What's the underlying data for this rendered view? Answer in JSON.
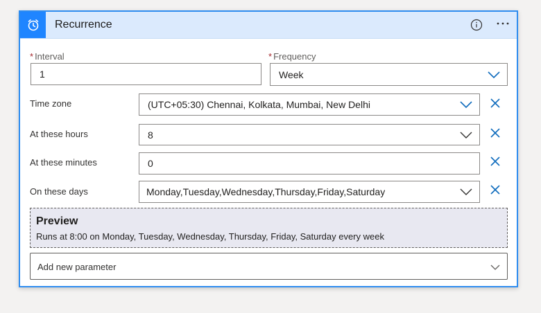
{
  "card": {
    "title": "Recurrence",
    "trigger_icon": "alarm-clock-icon",
    "info_icon": "info-icon",
    "more_icon": "more-icon"
  },
  "interval": {
    "label": "Interval",
    "required_mark": "*",
    "value": "1"
  },
  "frequency": {
    "label": "Frequency",
    "required_mark": "*",
    "value": "Week"
  },
  "params": [
    {
      "label": "Time zone",
      "value": "(UTC+05:30) Chennai, Kolkata, Mumbai, New Delhi"
    },
    {
      "label": "At these hours",
      "value": "8"
    },
    {
      "label": "At these minutes",
      "value": "0"
    },
    {
      "label": "On these days",
      "value": "Monday,Tuesday,Wednesday,Thursday,Friday,Saturday"
    }
  ],
  "preview": {
    "title": "Preview",
    "text": "Runs at 8:00 on Monday, Tuesday, Wednesday, Thursday, Friday, Saturday every week"
  },
  "add_parameter": {
    "label": "Add new parameter"
  },
  "colors": {
    "accent": "#1f85ff",
    "header_bg": "#dbeafd",
    "border": "#2d8cf0",
    "preview_bg": "#e8e8f1",
    "required": "#a4262c"
  }
}
